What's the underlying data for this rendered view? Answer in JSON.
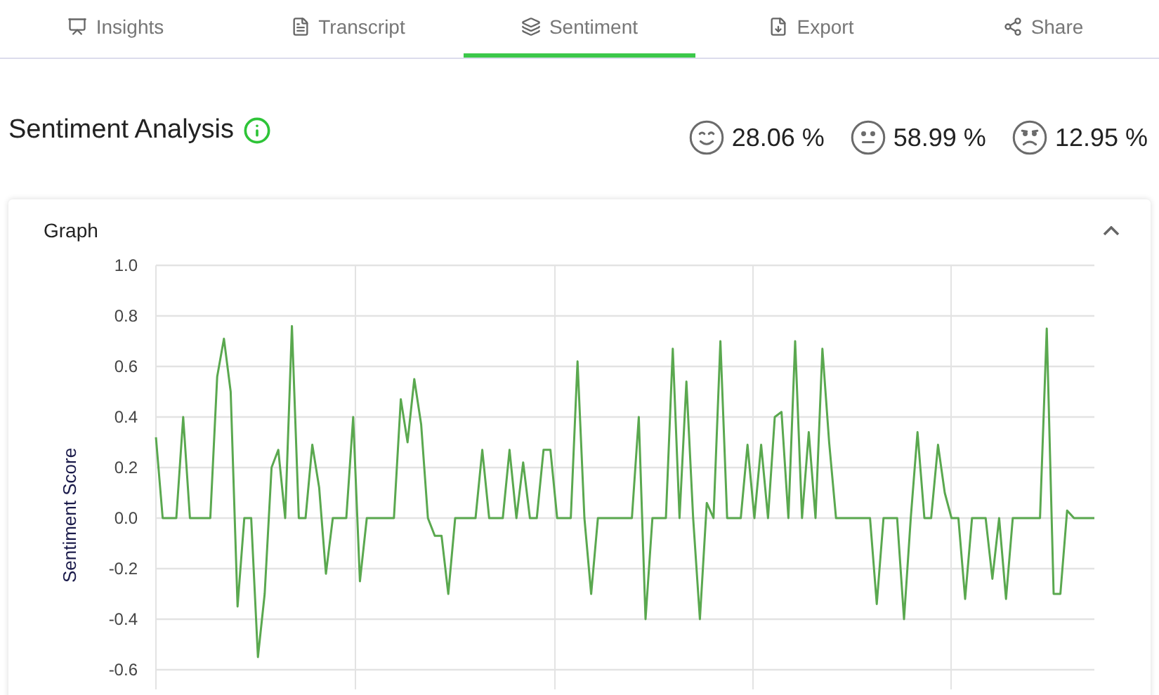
{
  "tabs": [
    {
      "kind": "insights",
      "label": "Insights",
      "selected": false
    },
    {
      "kind": "transcript",
      "label": "Transcript",
      "selected": false
    },
    {
      "kind": "sentiment",
      "label": "Sentiment",
      "selected": true
    },
    {
      "kind": "export",
      "label": "Export",
      "selected": false
    },
    {
      "kind": "share",
      "label": "Share",
      "selected": false
    }
  ],
  "heading": "Sentiment Analysis",
  "scores": [
    {
      "kind": "positive",
      "value": "28.06 %"
    },
    {
      "kind": "neutral",
      "value": "58.99 %"
    },
    {
      "kind": "negative",
      "value": "12.95 %"
    }
  ],
  "graph": {
    "title": "Graph",
    "expanded": true,
    "chart_data": {
      "type": "line",
      "grid": true,
      "ylabel": "Sentiment Score",
      "ylim": [
        -0.6,
        1.0
      ],
      "yticks": [
        {
          "value": 1.0,
          "label": "1.0"
        },
        {
          "value": 0.8,
          "label": "0.8"
        },
        {
          "value": 0.6,
          "label": "0.6"
        },
        {
          "value": 0.4,
          "label": "0.4"
        },
        {
          "value": 0.2,
          "label": "0.2"
        },
        {
          "value": 0.0,
          "label": "0.0"
        },
        {
          "value": -0.2,
          "label": "-0.2"
        },
        {
          "value": -0.4,
          "label": "-0.4"
        },
        {
          "value": -0.6,
          "label": "-0.6"
        }
      ],
      "series": [
        {
          "color": "#5aa84f",
          "values": [
            0.32,
            0,
            0,
            0,
            0.4,
            0,
            0,
            0,
            0,
            0.56,
            0.71,
            0.5,
            -0.35,
            0,
            0,
            -0.55,
            -0.3,
            0.2,
            0.27,
            0,
            0.76,
            0,
            0,
            0.29,
            0.12,
            -0.22,
            0,
            0,
            0,
            0.4,
            -0.25,
            0,
            0,
            0,
            0,
            0,
            0.47,
            0.3,
            0.55,
            0.37,
            0,
            -0.07,
            -0.07,
            -0.3,
            0,
            0,
            0,
            0,
            0.27,
            0,
            0,
            0,
            0.27,
            0,
            0.22,
            0,
            0,
            0.27,
            0.27,
            0,
            0,
            0,
            0.62,
            0,
            -0.3,
            0,
            0,
            0,
            0,
            0,
            0,
            0.4,
            -0.4,
            0,
            0,
            0,
            0.67,
            0,
            0.54,
            0,
            -0.4,
            0.06,
            0,
            0.7,
            0,
            0,
            0,
            0.29,
            0,
            0.29,
            0,
            0.4,
            0.42,
            0,
            0.7,
            0,
            0.34,
            0,
            0.67,
            0.3,
            0,
            0,
            0,
            0,
            0,
            0,
            -0.34,
            0,
            0,
            0,
            -0.4,
            0,
            0.34,
            0,
            0,
            0.29,
            0.1,
            0,
            0,
            -0.32,
            0,
            0,
            0,
            -0.24,
            0,
            -0.32,
            0,
            0,
            0,
            0,
            0,
            0.75,
            -0.3,
            -0.3,
            0.03,
            0,
            0,
            0,
            0
          ]
        }
      ]
    }
  }
}
